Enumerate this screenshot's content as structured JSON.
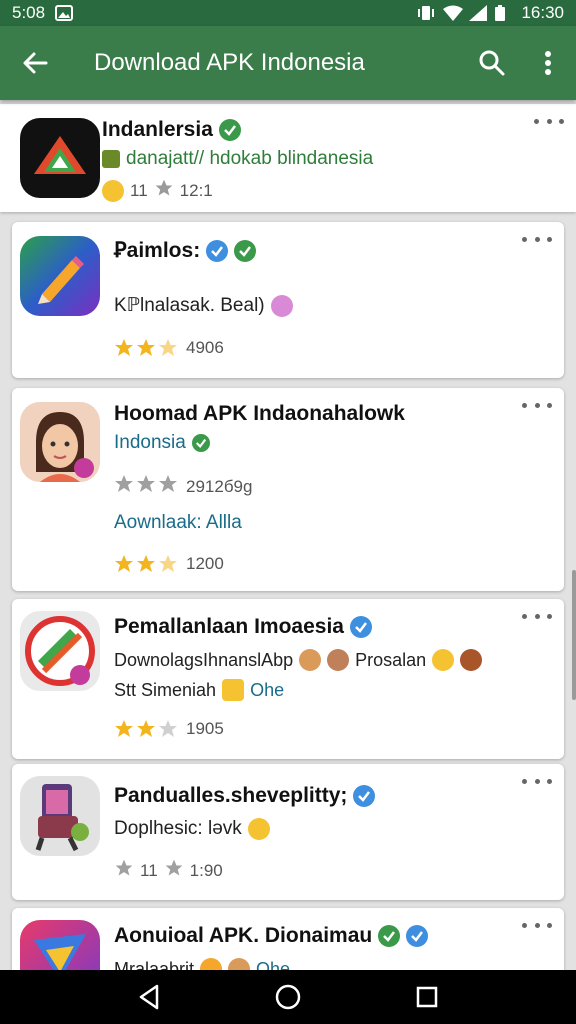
{
  "status_bar": {
    "time_left": "5:08",
    "time_right": "16:30"
  },
  "app_bar": {
    "title": "Download APK Indonesia"
  },
  "colors": {
    "app_bar": "#3a7d4a",
    "status_bar": "#2a6a3f",
    "star": "#f2b51d",
    "verified_green": "#3a9a4a",
    "verified_blue": "#3f8fe0"
  },
  "icons": [
    "back-arrow-icon",
    "search-icon",
    "more-vert-icon",
    "verified-icon",
    "star-icon",
    "back-nav-icon",
    "home-nav-icon",
    "recents-nav-icon"
  ],
  "apps": [
    {
      "name": "Indanlersia",
      "line1": "danajatt// hdokab blindanesia",
      "rating": "11",
      "count": "12:1"
    },
    {
      "name": "Ꝑaimlos:",
      "line1": "Kℙlnalasak. Beal)",
      "rating_value": 2.5,
      "count": "4906"
    },
    {
      "name": "Hoomad APK Indaonahalowk",
      "line1": "Indonsia",
      "count_a": "2912б9g",
      "line2": "Aownlaak: Allla",
      "rating_value": 2.5,
      "count": "1200"
    },
    {
      "name": "Pemallanlaan Imoaesia",
      "line1": "DownolagsIhnanslAbp",
      "line1_suffix": "Prosalan",
      "line2": "Stt Simeniah",
      "line2_suffix": "Ohe",
      "rating_value": 2.5,
      "count": "1905"
    },
    {
      "name": "Pandualles.sheveplitty;",
      "line1": "Doplhesic: lǝvk",
      "rating": "11",
      "count": "1:90"
    },
    {
      "name": "Aonuioal APK. Dionaimau",
      "line1": "Mralaabrit",
      "line1_suffix": "Ohe"
    }
  ]
}
